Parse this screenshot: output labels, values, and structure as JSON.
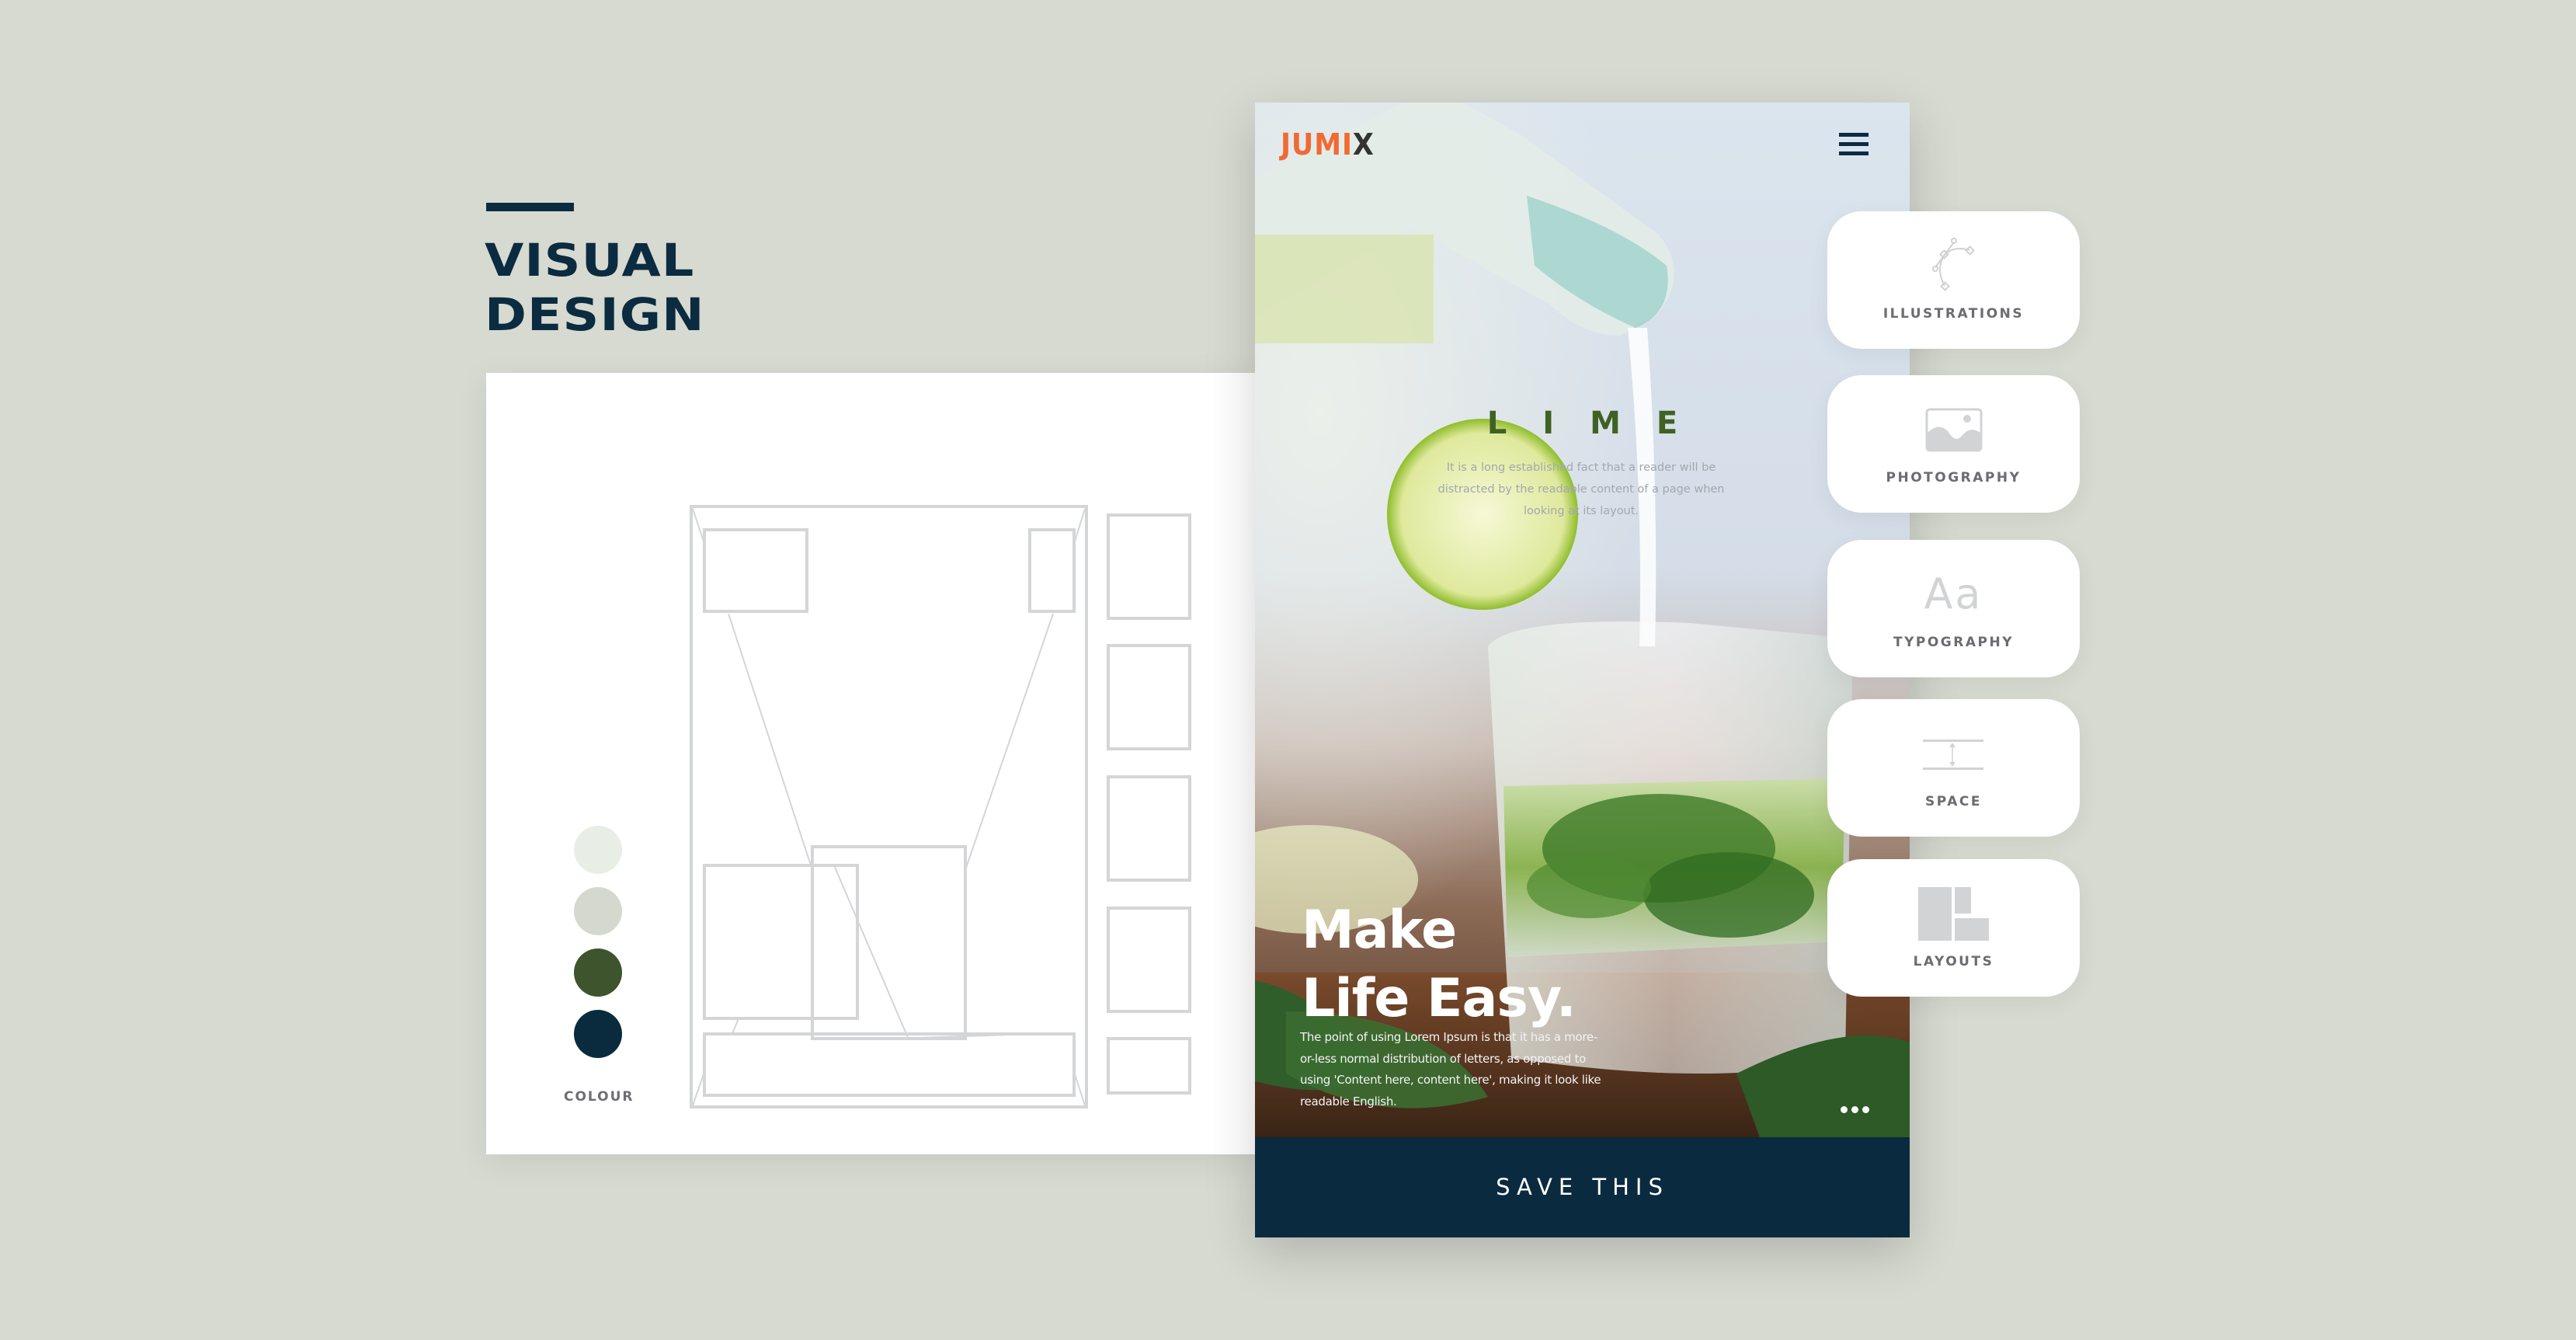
{
  "heading": {
    "line1": "VISUAL",
    "line2": "DESIGN"
  },
  "palette": {
    "label": "COLOUR",
    "swatches": [
      {
        "name": "mint-mist",
        "color": "#e8ede6"
      },
      {
        "name": "sage-grey",
        "color": "#d5d8cf"
      },
      {
        "name": "forest-green",
        "color": "#3d542d"
      },
      {
        "name": "navy",
        "color": "#0a2b3e"
      }
    ]
  },
  "phone": {
    "logo_main": "JUMI",
    "logo_accent": "X",
    "logo_colors": {
      "main": "#f06a32",
      "accent": "#333333"
    },
    "menu_icon": "hamburger-icon",
    "feature": {
      "title": "LIME",
      "text": "It is a long established fact that a reader will be distracted by the readable content of a page when looking at its layout."
    },
    "headline_line1": "Make",
    "headline_line2": "Life Easy.",
    "body": "The point of using Lorem Ipsum is that it has a more-or-less normal distribution of letters, as opposed to using 'Content here, content here', making it look like readable English.",
    "more_icon": "more-dots-icon",
    "cta_label": "SAVE THIS",
    "cta_color": "#0a2a3f"
  },
  "categories": [
    {
      "label": "ILLUSTRATIONS",
      "icon": "bezier-pen-icon"
    },
    {
      "label": "PHOTOGRAPHY",
      "icon": "image-icon"
    },
    {
      "label": "TYPOGRAPHY",
      "icon": "typography-icon",
      "glyph": "Aa"
    },
    {
      "label": "SPACE",
      "icon": "spacing-icon"
    },
    {
      "label": "LAYOUTS",
      "icon": "layout-grid-icon"
    }
  ],
  "colors": {
    "background": "#d7dad0",
    "heading": "#0b2b40",
    "wireframe_stroke": "#d4d5d7",
    "card_label": "#6b6b70",
    "lime_green": "#3f6224"
  }
}
